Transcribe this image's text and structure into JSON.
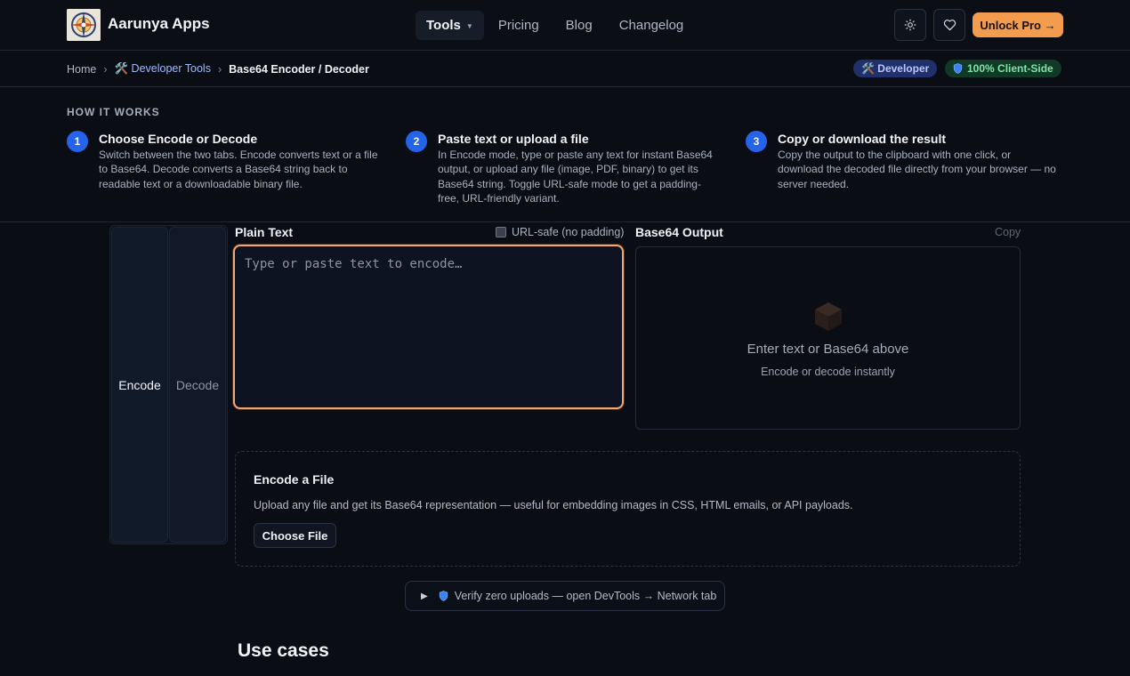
{
  "header": {
    "brand": "Aarunya Apps",
    "nav": [
      {
        "label": "Tools",
        "active": true,
        "has_caret": true
      },
      {
        "label": "Pricing"
      },
      {
        "label": "Blog"
      },
      {
        "label": "Changelog"
      }
    ],
    "pro_button": "Unlock Pro →",
    "accent_color": "#f39c4e"
  },
  "breadcrumb": {
    "home": "Home",
    "section": "🛠️ Developer Tools",
    "current": "Base64 Encoder / Decoder",
    "separator": "›",
    "badges": {
      "developer": "🛠️ Developer",
      "client_side": "100% Client-Side"
    }
  },
  "how_it_works": {
    "title": "HOW IT WORKS",
    "steps": [
      {
        "num": "1",
        "title": "Choose Encode or Decode",
        "desc": "Switch between the two tabs. Encode converts text or a file to Base64. Decode converts a Base64 string back to readable text or a downloadable binary file."
      },
      {
        "num": "2",
        "title": "Paste text or upload a file",
        "desc": "In Encode mode, type or paste any text for instant Base64 output, or upload any file (image, PDF, binary) to get its Base64 string. Toggle URL-safe mode to get a padding-free, URL-friendly variant."
      },
      {
        "num": "3",
        "title": "Copy or download the result",
        "desc": "Copy the output to the clipboard with one click, or download the decoded file directly from your browser — no server needed."
      }
    ]
  },
  "tabs": {
    "encode": "Encode",
    "decode": "Decode",
    "active": "encode"
  },
  "input": {
    "label": "Plain Text",
    "url_safe_label": "URL-safe (no padding)",
    "url_safe_checked": false,
    "placeholder": "Type or paste text to encode…",
    "value": ""
  },
  "output": {
    "label": "Base64 Output",
    "copy": "Copy",
    "empty_title": "Enter text or Base64 above",
    "empty_sub": "Encode or decode instantly",
    "empty_icon": "cube-icon"
  },
  "file_encode": {
    "title": "Encode a File",
    "desc": "Upload any file and get its Base64 representation — useful for embedding images in CSS, HTML emails, or API payloads.",
    "button": "Choose File"
  },
  "verify": {
    "label": "Verify zero uploads — open DevTools → Network tab"
  },
  "section_heading": "Use cases"
}
